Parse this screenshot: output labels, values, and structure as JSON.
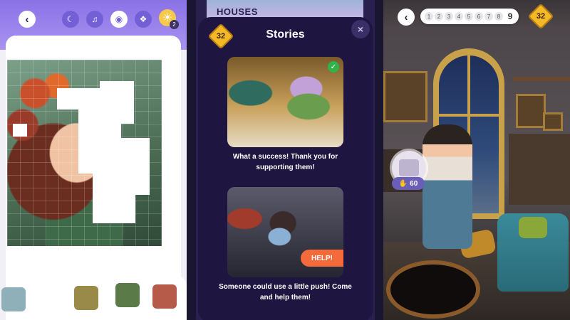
{
  "panel_puzzle": {
    "hint_count": "2",
    "icons": [
      "back-icon",
      "moon-icon",
      "music-icon",
      "eye-icon",
      "puzzle-icon",
      "lightbulb-icon"
    ]
  },
  "panel_stories": {
    "houses_label": "HOUSES",
    "badge_value": "32",
    "title": "Stories",
    "close_label": "×",
    "stories": [
      {
        "text": "What a success! Thank you for supporting them!",
        "status": "completed"
      },
      {
        "text": "Someone could use a little push! Come and help them!",
        "action_label": "HELP!"
      }
    ]
  },
  "panel_room": {
    "levels": [
      "1",
      "2",
      "3",
      "4",
      "5",
      "6",
      "7",
      "8",
      "9"
    ],
    "badge_value": "32",
    "cost_value": "60"
  },
  "colors": {
    "accent_purple": "#8a72e6",
    "badge_gold": "#f4b927",
    "help_orange": "#f56a3a",
    "modal_bg": "#1e1640",
    "success_green": "#2fb34a"
  }
}
